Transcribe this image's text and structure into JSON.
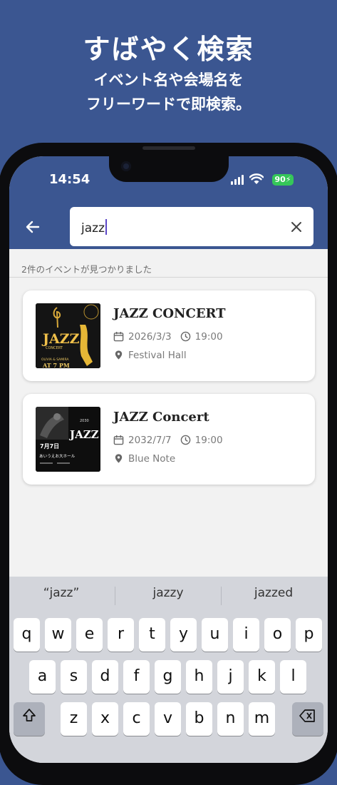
{
  "promo": {
    "title": "すばやく検索",
    "line1": "イベント名や会場名を",
    "line2": "フリーワードで即検索。"
  },
  "status_bar": {
    "time": "14:54",
    "battery": "90",
    "icons": [
      "signal-icon",
      "wifi-icon",
      "battery-icon"
    ]
  },
  "search": {
    "value": "jazz"
  },
  "results": {
    "count_text": "2件のイベントが見つかりました",
    "events": [
      {
        "title": "JAZZ CONCERT",
        "date": "2026/3/3",
        "time": "19:00",
        "venue": "Festival Hall",
        "poster": {
          "word": "JAZZ",
          "sub": "CONCERT",
          "lines": [
            "OLIVIA & SAMIRA",
            "AT 7 PM"
          ]
        }
      },
      {
        "title": "JAZZ Concert",
        "date": "2032/7/7",
        "time": "19:00",
        "venue": "Blue Note",
        "poster": {
          "word": "JAZZ",
          "year": "2030",
          "date": "7月7日",
          "venue": "あいうえお大ホール"
        }
      }
    ]
  },
  "keyboard": {
    "suggestions": [
      "“jazz”",
      "jazzy",
      "jazzed"
    ],
    "row1": [
      "q",
      "w",
      "e",
      "r",
      "t",
      "y",
      "u",
      "i",
      "o",
      "p"
    ],
    "row2": [
      "a",
      "s",
      "d",
      "f",
      "g",
      "h",
      "j",
      "k",
      "l"
    ],
    "row3": [
      "z",
      "x",
      "c",
      "v",
      "b",
      "n",
      "m"
    ]
  },
  "colors": {
    "brand": "#3b5691",
    "accent_caret": "#5b46c6",
    "battery": "#35c759"
  }
}
